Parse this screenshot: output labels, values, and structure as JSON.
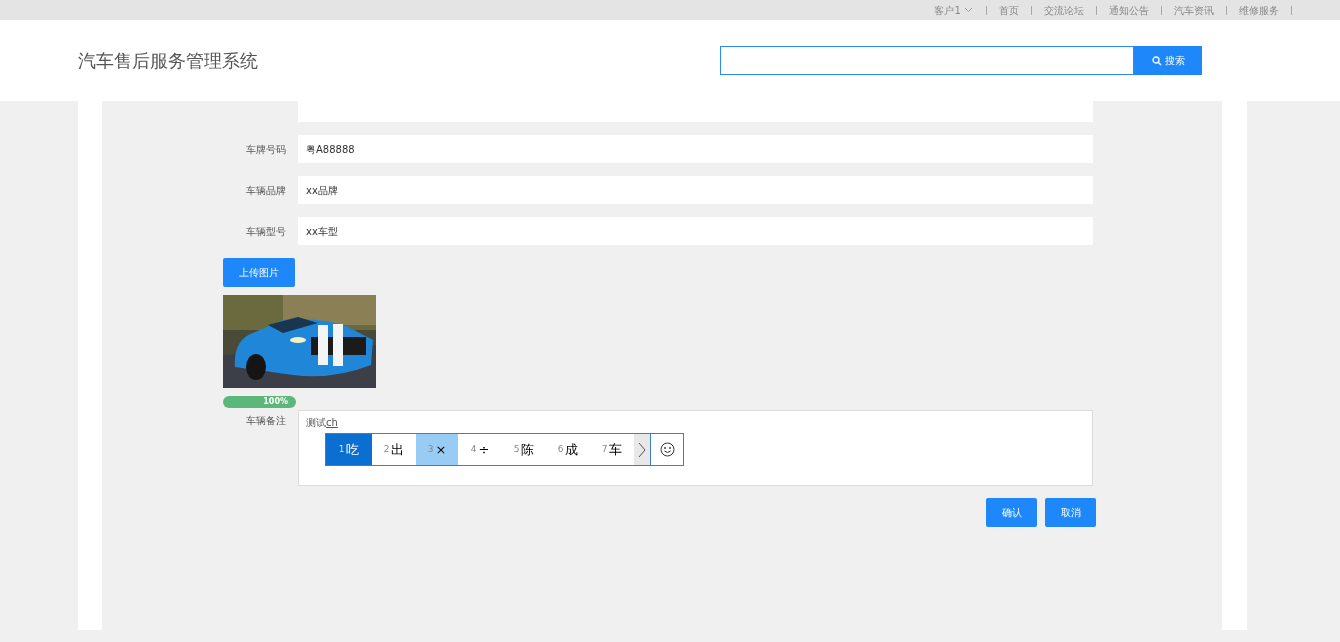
{
  "top_bar": {
    "account": "客户1",
    "links": [
      "首页",
      "交流论坛",
      "通知公告",
      "汽车资讯",
      "维修服务"
    ]
  },
  "header": {
    "title": "汽车售后服务管理系统",
    "search": {
      "button": "搜索"
    }
  },
  "form": {
    "fields": [
      {
        "label": "车牌号码",
        "value": "粤A88888"
      },
      {
        "label": "车辆品牌",
        "value": "xx品牌"
      },
      {
        "label": "车辆型号",
        "value": "xx车型"
      }
    ],
    "upload_button": "上传图片",
    "image": {
      "kind": "picture"
    },
    "upload_progress": {
      "level": 1,
      "reading": "100%"
    },
    "remark": {
      "label": "车辆备注",
      "value": "测试",
      "composing": "ch"
    },
    "ime": {
      "candidates": [
        {
          "index": "1",
          "text": "吃",
          "selected": true,
          "hovered": false
        },
        {
          "index": "2",
          "text": "出",
          "selected": false,
          "hovered": false
        },
        {
          "index": "3",
          "text": "×",
          "selected": false,
          "hovered": true
        },
        {
          "index": "4",
          "text": "÷",
          "selected": false,
          "hovered": false
        },
        {
          "index": "5",
          "text": "陈",
          "selected": false,
          "hovered": false
        },
        {
          "index": "6",
          "text": "成",
          "selected": false,
          "hovered": false
        },
        {
          "index": "7",
          "text": "车",
          "selected": false,
          "hovered": false
        }
      ]
    },
    "buttons": [
      "确认",
      "取消"
    ]
  }
}
